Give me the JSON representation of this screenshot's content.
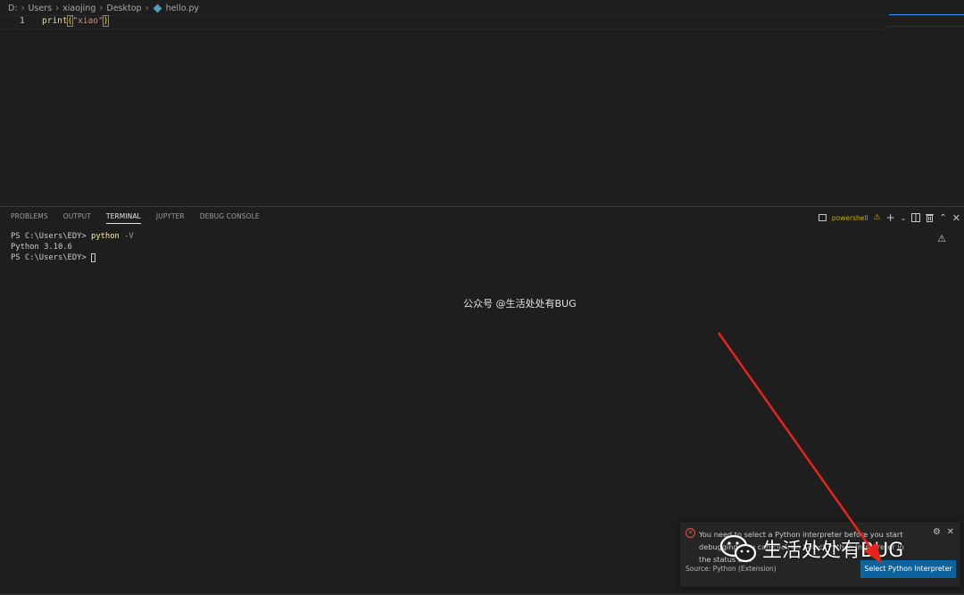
{
  "breadcrumb": {
    "items": [
      "D:",
      "Users",
      "xiaojing",
      "Desktop"
    ],
    "file": "hello.py"
  },
  "editor": {
    "line_number": "1",
    "code": {
      "fn": "print",
      "open": "(",
      "str": "\"xiao\"",
      "close": ")"
    }
  },
  "panel": {
    "tabs": [
      "PROBLEMS",
      "OUTPUT",
      "TERMINAL",
      "JUPYTER",
      "DEBUG CONSOLE"
    ],
    "active_tab": "TERMINAL",
    "shell_label": "powershell"
  },
  "terminal": {
    "line1_prompt": "PS C:\\Users\\EDY> ",
    "line1_cmd": "python",
    "line1_flag": " -V",
    "line2": "Python 3.10.6",
    "line3_prompt": "PS C:\\Users\\EDY> "
  },
  "watermark": {
    "top_text": "公众号 @生活处处有BUG",
    "big_text": "生活处处有BUG"
  },
  "notification": {
    "message": "You need to select a Python interpreter before you start debugging. You can click on Select Python Interpreter in the status bar.",
    "source": "Source: Python (Extension)",
    "button_label": "Select Python Interpreter"
  },
  "colors": {
    "accent": "#0e639c",
    "error": "#f14c4c",
    "warning": "#cca700",
    "arrow": "#e8231b"
  }
}
